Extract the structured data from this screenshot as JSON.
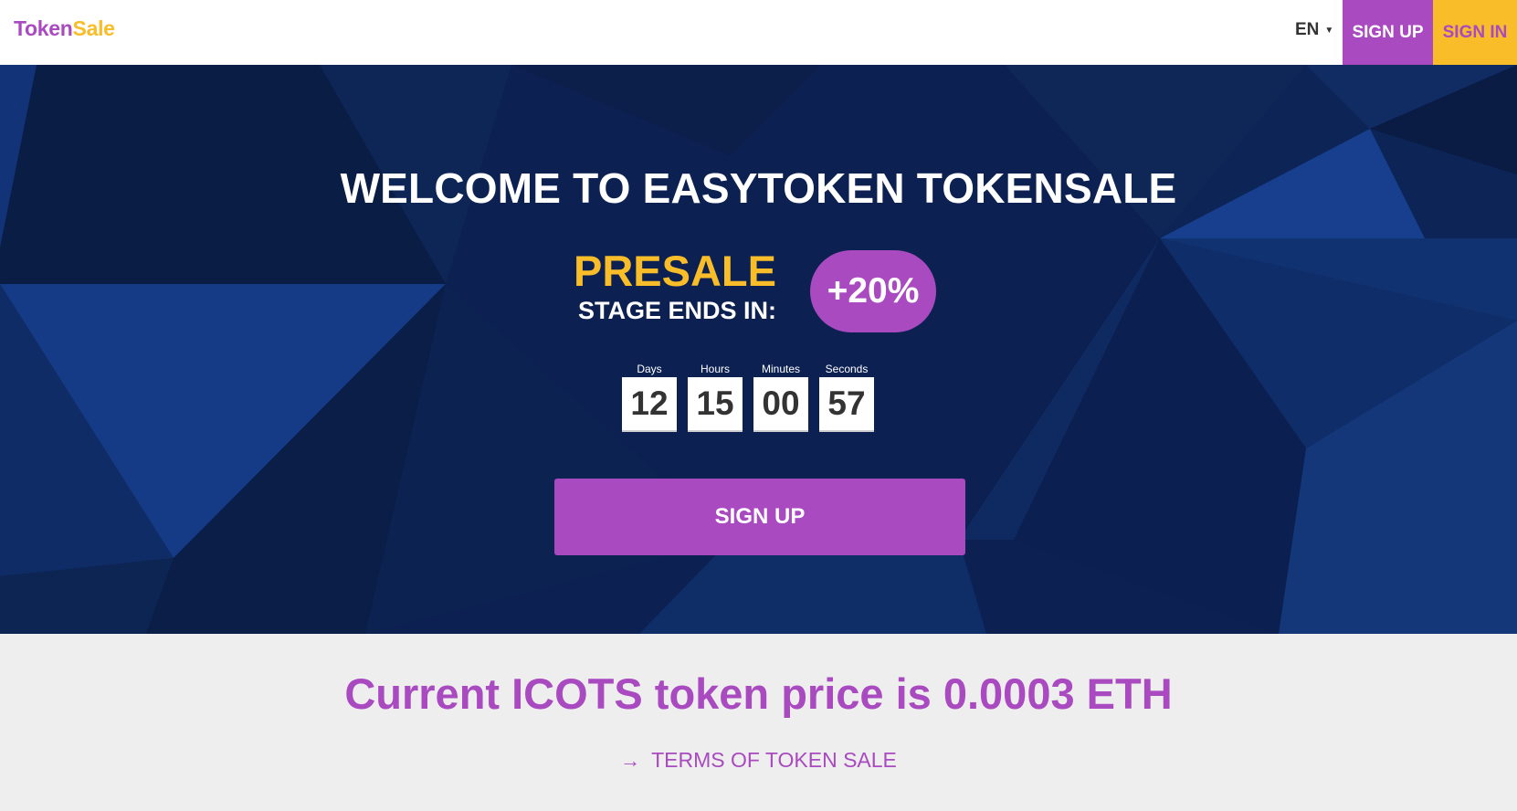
{
  "header": {
    "logo_part1": "Token",
    "logo_part2": "Sale",
    "language": "EN",
    "signup_label": "SIGN UP",
    "signin_label": "SIGN IN"
  },
  "hero": {
    "title": "WELCOME TO EASYTOKEN TOKENSALE",
    "stage_name": "PRESALE",
    "stage_ends": "STAGE ENDS IN:",
    "bonus": "+20%",
    "countdown": [
      {
        "label": "Days",
        "value": "12"
      },
      {
        "label": "Hours",
        "value": "15"
      },
      {
        "label": "Minutes",
        "value": "00"
      },
      {
        "label": "Seconds",
        "value": "57"
      }
    ],
    "signup_label": "SIGN UP"
  },
  "price_section": {
    "price_text": "Current ICOTS token price is 0.0003 ETH",
    "terms_label": "TERMS OF TOKEN SALE",
    "terms_icon": "arrow-right-icon"
  },
  "colors": {
    "brand_purple": "#a94ac0",
    "brand_yellow": "#f8bd28",
    "hero_bg": "#0d2350",
    "section_bg": "#eeeeee"
  }
}
